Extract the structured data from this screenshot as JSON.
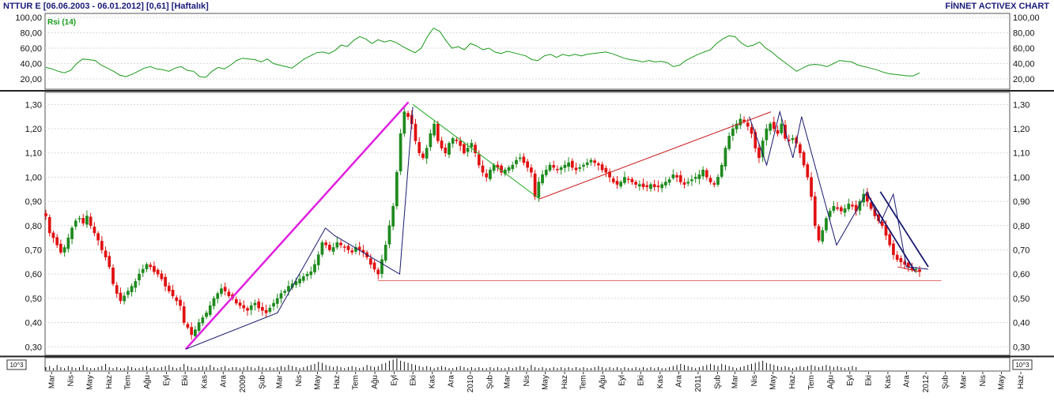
{
  "header": {
    "title": "NTTUR E  [06.06.2003 - 06.01.2012]  [0,61]  [Haftalık]",
    "brand": "FİNNET ACTIVEX CHART"
  },
  "colors": {
    "rsi": "#1a9a1a",
    "up": "#1e8a1e",
    "down": "#e01010",
    "magenta": "#e020e0",
    "navy": "#1a1a70",
    "red_line": "#cc2020",
    "green_line": "#20aa20",
    "support": "#e07070"
  },
  "chart_data": [
    {
      "type": "line",
      "title": "Rsi (14)",
      "y_ticks": [
        "100,00",
        "80,00",
        "60,00",
        "40,00",
        "20,00"
      ],
      "ylim": [
        20,
        100
      ],
      "series": [
        {
          "name": "Rsi (14)",
          "x_start": "2008-03-07",
          "x_end": "2012-01-06",
          "values": [
            35,
            33,
            30,
            28,
            31,
            40,
            46,
            45,
            44,
            38,
            34,
            30,
            25,
            23,
            26,
            30,
            34,
            36,
            33,
            32,
            30,
            34,
            36,
            31,
            30,
            23,
            22,
            30,
            35,
            33,
            38,
            44,
            47,
            46,
            45,
            42,
            46,
            40,
            38,
            36,
            34,
            40,
            46,
            50,
            54,
            55,
            53,
            57,
            64,
            62,
            70,
            75,
            72,
            66,
            71,
            68,
            70,
            67,
            62,
            58,
            54,
            60,
            75,
            86,
            82,
            70,
            60,
            62,
            58,
            66,
            63,
            58,
            60,
            55,
            53,
            56,
            54,
            52,
            50,
            45,
            44,
            50,
            52,
            48,
            52,
            50,
            52,
            50,
            52,
            53,
            54,
            55,
            53,
            50,
            47,
            45,
            44,
            42,
            44,
            42,
            43,
            41,
            36,
            38,
            44,
            48,
            52,
            55,
            58,
            66,
            72,
            76,
            75,
            67,
            62,
            64,
            68,
            60,
            55,
            48,
            42,
            36,
            30,
            34,
            38,
            39,
            38,
            36,
            40,
            44,
            43,
            42,
            38,
            36,
            34,
            32,
            29,
            27,
            26,
            25,
            24,
            24,
            28
          ]
        }
      ]
    },
    {
      "type": "candlestick",
      "y_ticks": [
        "1,30",
        "1,20",
        "1,10",
        "1,00",
        "0,90",
        "0,80",
        "0,70",
        "0,60",
        "0,50",
        "0,40",
        "0,30"
      ],
      "ylim": [
        0.265,
        1.35
      ],
      "x_start": "2008-03-07",
      "x_end": "2012-01-06",
      "closes": [
        0.84,
        0.77,
        0.75,
        0.72,
        0.69,
        0.71,
        0.75,
        0.79,
        0.82,
        0.83,
        0.81,
        0.84,
        0.8,
        0.77,
        0.74,
        0.7,
        0.67,
        0.63,
        0.56,
        0.52,
        0.49,
        0.51,
        0.53,
        0.55,
        0.57,
        0.6,
        0.62,
        0.64,
        0.63,
        0.61,
        0.6,
        0.58,
        0.55,
        0.53,
        0.51,
        0.49,
        0.47,
        0.4,
        0.38,
        0.35,
        0.37,
        0.4,
        0.42,
        0.44,
        0.47,
        0.5,
        0.52,
        0.54,
        0.53,
        0.51,
        0.5,
        0.48,
        0.47,
        0.46,
        0.45,
        0.47,
        0.48,
        0.46,
        0.45,
        0.44,
        0.46,
        0.48,
        0.5,
        0.52,
        0.53,
        0.55,
        0.56,
        0.57,
        0.58,
        0.59,
        0.6,
        0.61,
        0.64,
        0.68,
        0.73,
        0.72,
        0.7,
        0.71,
        0.73,
        0.72,
        0.71,
        0.7,
        0.69,
        0.71,
        0.7,
        0.69,
        0.67,
        0.64,
        0.62,
        0.6,
        0.66,
        0.72,
        0.8,
        0.88,
        1.02,
        1.18,
        1.27,
        1.25,
        1.22,
        1.15,
        1.1,
        1.08,
        1.12,
        1.18,
        1.22,
        1.15,
        1.12,
        1.1,
        1.14,
        1.16,
        1.15,
        1.13,
        1.1,
        1.12,
        1.14,
        1.1,
        1.05,
        1.02,
        1.0,
        1.03,
        1.05,
        1.04,
        1.02,
        1.03,
        1.04,
        1.05,
        1.07,
        1.08,
        1.06,
        1.04,
        1.02,
        0.92,
        0.98,
        1.01,
        1.03,
        1.05,
        1.04,
        1.03,
        1.04,
        1.05,
        1.06,
        1.04,
        1.03,
        1.04,
        1.05,
        1.06,
        1.07,
        1.06,
        1.05,
        1.03,
        1.02,
        1.0,
        0.98,
        0.97,
        0.98,
        1.0,
        0.99,
        0.98,
        0.97,
        0.97,
        0.96,
        0.96,
        0.97,
        0.96,
        0.96,
        0.97,
        0.98,
        0.99,
        1.01,
        1.0,
        0.98,
        0.97,
        0.98,
        0.99,
        1.0,
        1.01,
        1.03,
        1.0,
        0.98,
        0.97,
        1.0,
        1.05,
        1.12,
        1.17,
        1.2,
        1.22,
        1.24,
        1.23,
        1.21,
        1.18,
        1.12,
        1.08,
        1.15,
        1.2,
        1.22,
        1.2,
        1.18,
        1.22,
        1.16,
        1.15,
        1.16,
        1.14,
        1.1,
        1.05,
        1.0,
        0.92,
        0.8,
        0.74,
        0.78,
        0.83,
        0.86,
        0.88,
        0.87,
        0.86,
        0.87,
        0.89,
        0.88,
        0.86,
        0.9,
        0.93,
        0.9,
        0.87,
        0.84,
        0.82,
        0.8,
        0.76,
        0.72,
        0.68,
        0.66,
        0.65,
        0.64,
        0.63,
        0.62,
        0.62,
        0.61
      ],
      "support_level": 0.573,
      "trendlines": [
        {
          "color": "magenta",
          "points": [
            [
              "2008-10-17",
              0.29
            ],
            [
              "2009-10-09",
              1.31
            ]
          ]
        },
        {
          "color": "navy",
          "points": [
            [
              "2008-10-17",
              0.29
            ],
            [
              "2009-03-13",
              0.44
            ],
            [
              "2009-05-29",
              0.79
            ],
            [
              "2009-06-12",
              0.76
            ],
            [
              "2009-09-25",
              0.6
            ],
            [
              "2009-10-16",
              1.29
            ]
          ]
        },
        {
          "color": "green_line",
          "points": [
            [
              "2009-10-16",
              1.3
            ],
            [
              "2010-05-07",
              0.91
            ]
          ]
        },
        {
          "color": "red_line",
          "points": [
            [
              "2010-05-07",
              0.91
            ],
            [
              "2011-05-13",
              1.27
            ]
          ]
        },
        {
          "color": "navy",
          "points": [
            [
              "2011-04-08",
              1.25
            ],
            [
              "2011-05-06",
              1.05
            ],
            [
              "2011-05-27",
              1.27
            ],
            [
              "2011-06-17",
              1.08
            ],
            [
              "2011-07-01",
              1.25
            ],
            [
              "2011-08-26",
              0.72
            ],
            [
              "2011-10-14",
              0.94
            ],
            [
              "2011-11-04",
              0.81
            ],
            [
              "2011-11-25",
              0.93
            ],
            [
              "2011-12-16",
              0.63
            ],
            [
              "2012-01-20",
              0.62
            ]
          ]
        },
        {
          "color": "navy",
          "points": [
            [
              "2011-10-14",
              0.93
            ],
            [
              "2011-12-30",
              0.61
            ]
          ]
        },
        {
          "color": "navy",
          "points": [
            [
              "2011-11-04",
              0.94
            ],
            [
              "2012-01-20",
              0.63
            ]
          ]
        },
        {
          "color": "red_line",
          "points": [
            [
              "2011-12-02",
              0.63
            ],
            [
              "2012-01-06",
              0.61
            ]
          ]
        }
      ]
    },
    {
      "type": "bar",
      "unit_label": "10^3",
      "volumes": [
        3,
        4,
        2,
        5,
        3,
        2,
        4,
        3,
        2,
        3,
        5,
        3,
        2,
        2,
        3,
        4,
        6,
        3,
        2,
        3,
        2,
        2,
        4,
        3,
        2,
        2,
        3,
        4,
        2,
        3,
        2,
        3,
        4,
        5,
        3,
        2,
        3,
        6,
        4,
        3,
        2,
        3,
        4,
        3,
        5,
        3,
        2,
        3,
        4,
        2,
        3,
        3,
        2,
        3,
        4,
        3,
        2,
        4,
        3,
        2,
        3,
        2,
        3,
        4,
        3,
        5,
        4,
        3,
        2,
        3,
        4,
        5,
        6,
        8,
        7,
        5,
        4,
        3,
        4,
        3,
        2,
        3,
        4,
        3,
        2,
        3,
        5,
        4,
        3,
        4,
        6,
        7,
        9,
        10,
        11,
        9,
        8,
        7,
        6,
        5,
        4,
        3,
        4,
        3,
        2,
        3,
        4,
        3,
        2,
        2,
        3,
        4,
        3,
        2,
        3,
        2,
        3,
        2,
        2,
        3,
        2,
        3,
        2,
        2,
        3,
        2,
        3,
        4,
        3,
        2,
        5,
        3,
        2,
        3,
        2,
        2,
        3,
        2,
        3,
        2,
        3,
        2,
        3,
        2,
        3,
        2,
        2,
        3,
        4,
        3,
        2,
        3,
        2,
        3,
        2,
        3,
        2,
        2,
        3,
        2,
        3,
        2,
        3,
        2,
        3,
        2,
        2,
        3,
        4,
        5,
        6,
        5,
        4,
        3,
        2,
        3,
        4,
        5,
        6,
        5,
        4,
        6,
        5,
        4,
        3,
        2,
        3,
        4,
        5,
        6,
        7,
        8,
        9,
        7,
        6,
        5,
        4,
        3,
        4,
        3,
        2,
        3,
        4,
        3,
        4,
        5,
        4,
        3,
        4,
        5,
        4,
        3,
        4,
        3,
        2,
        3,
        4,
        3
      ]
    }
  ],
  "x_axis": {
    "labels": [
      "Mar",
      "Nis",
      "May",
      "Haz",
      "Tem",
      "Ağu",
      "Eyl",
      "Eki",
      "Kas",
      "Ara",
      "2009",
      "Şub",
      "Mar",
      "Nis",
      "May",
      "Haz",
      "Tem",
      "Ağu",
      "Eyl",
      "Eki",
      "Kas",
      "Ara",
      "2010",
      "Şub",
      "Mar",
      "Nis",
      "May",
      "Haz",
      "Tem",
      "Ağu",
      "Eyl",
      "Eki",
      "Kas",
      "Ara",
      "2011",
      "Şub",
      "Mar",
      "Nis",
      "May",
      "Haz",
      "Tem",
      "Ağu",
      "Eyl",
      "Eki",
      "Kas",
      "Ara",
      "2012",
      "Şub",
      "Mar",
      "Nis",
      "May",
      "Haz"
    ]
  }
}
